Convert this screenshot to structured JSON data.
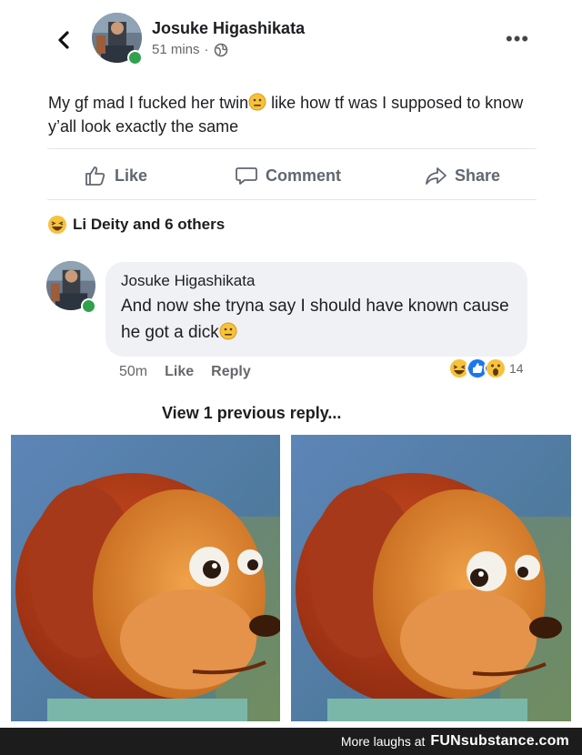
{
  "post": {
    "author": "Josuke Higashikata",
    "time": "51 mins",
    "separator": "·",
    "text_part1": "My gf mad I fucked her twin",
    "text_part2": " like how tf was I supposed to know y’all look exactly the same",
    "like_label": "Like",
    "comment_label": "Comment",
    "share_label": "Share",
    "reactions_label": "Li Deity and 6 others"
  },
  "comment": {
    "author": "Josuke Higashikata",
    "text": "And now she tryna say I should have known cause he got a dick",
    "time": "50m",
    "like_label": "Like",
    "reply_label": "Reply",
    "reaction_count": "14"
  },
  "view_replies": "View 1 previous reply...",
  "footer": {
    "prefix": "More laughs at",
    "brand": "FUNsubstance.com"
  },
  "colors": {
    "online": "#31a24c",
    "like_blue": "#1877f2",
    "emoji_yellow": "#f7c23b",
    "footer_bg": "#1c1c1c"
  }
}
